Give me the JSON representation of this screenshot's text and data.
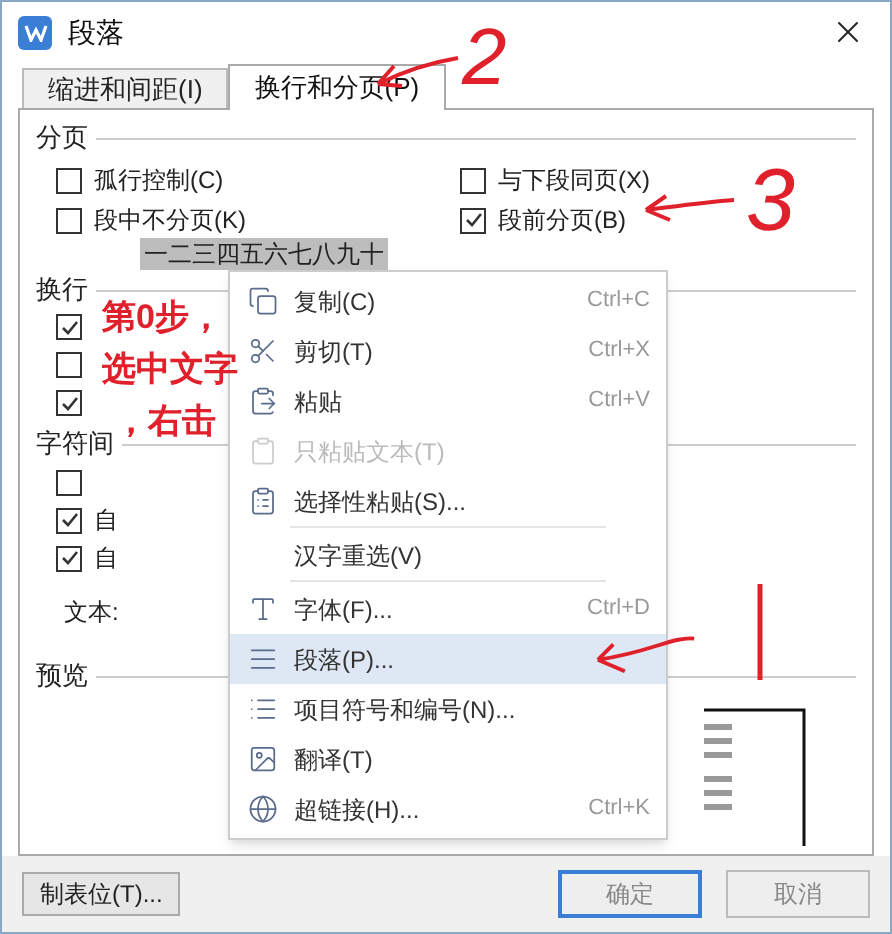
{
  "window": {
    "title": "段落"
  },
  "tabs": [
    {
      "label": "缩进和间距(I)",
      "selected": false
    },
    {
      "label": "换行和分页(P)",
      "selected": true
    }
  ],
  "pagination": {
    "title": "分页",
    "options": [
      {
        "label": "孤行控制(C)",
        "checked": false
      },
      {
        "label": "与下段同页(X)",
        "checked": false
      },
      {
        "label": "段中不分页(K)",
        "checked": false
      },
      {
        "label": "段前分页(B)",
        "checked": true
      }
    ]
  },
  "selected_text": "一二三四五六七八九十",
  "line_break": {
    "title": "换行",
    "options": [
      {
        "checked": true
      },
      {
        "checked": false
      },
      {
        "checked": true
      }
    ]
  },
  "character_spacing": {
    "title": "字符间",
    "options": [
      {
        "checked": false
      },
      {
        "label": "自",
        "checked": true
      },
      {
        "label": "自",
        "checked": true
      }
    ]
  },
  "text_alignment_label": "文本:",
  "preview": {
    "title": "预览"
  },
  "context_menu": [
    {
      "label": "复制(C)",
      "shortcut": "Ctrl+C",
      "disabled": false,
      "selected": false,
      "separator_after": false
    },
    {
      "label": "剪切(T)",
      "shortcut": "Ctrl+X",
      "disabled": false,
      "selected": false,
      "separator_after": false
    },
    {
      "label": "粘贴",
      "shortcut": "Ctrl+V",
      "disabled": false,
      "selected": false,
      "separator_after": false
    },
    {
      "label": "只粘贴文本(T)",
      "disabled": true,
      "selected": false,
      "separator_after": false
    },
    {
      "label": "选择性粘贴(S)...",
      "disabled": false,
      "selected": false,
      "separator_after": true
    },
    {
      "label": "汉字重选(V)",
      "disabled": false,
      "selected": false,
      "separator_after": true
    },
    {
      "label": "字体(F)...",
      "shortcut": "Ctrl+D",
      "disabled": false,
      "selected": false,
      "separator_after": false
    },
    {
      "label": "段落(P)...",
      "disabled": false,
      "selected": true,
      "separator_after": false
    },
    {
      "label": "项目符号和编号(N)...",
      "disabled": false,
      "selected": false,
      "separator_after": false
    },
    {
      "label": "翻译(T)",
      "disabled": false,
      "selected": false,
      "separator_after": false
    },
    {
      "label": "超链接(H)...",
      "shortcut": "Ctrl+K",
      "disabled": false,
      "selected": false,
      "separator_after": false
    }
  ],
  "buttons": {
    "tab_stops": "制表位(T)...",
    "ok": "确定",
    "cancel": "取消"
  },
  "annotations": {
    "step_tabs": "2",
    "step_checkbox": "3",
    "step_zero": [
      "第0步，",
      "选中文字",
      "，右击"
    ]
  }
}
